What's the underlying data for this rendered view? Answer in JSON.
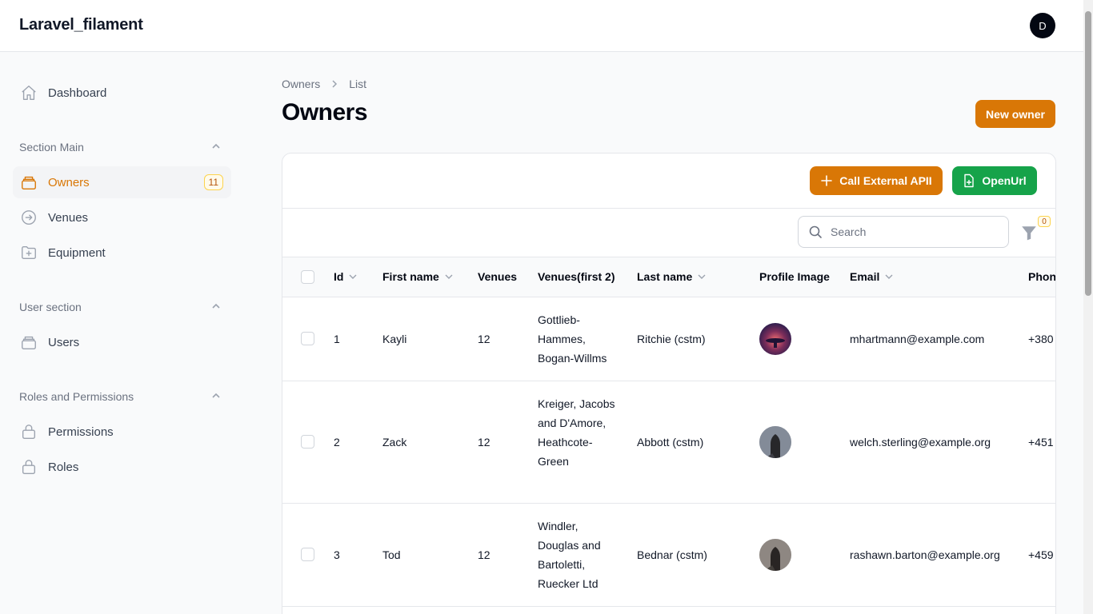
{
  "app": {
    "title": "Laravel_filament",
    "user_initial": "D"
  },
  "sidebar": {
    "dashboard": "Dashboard",
    "groups": [
      {
        "label": "Section Main",
        "items": [
          {
            "label": "Owners",
            "badge": "11",
            "icon": "rectangle-stack-icon",
            "active": true
          },
          {
            "label": "Venues",
            "icon": "arrow-circle-right-icon"
          },
          {
            "label": "Equipment",
            "icon": "folder-plus-icon"
          }
        ]
      },
      {
        "label": "User section",
        "items": [
          {
            "label": "Users",
            "icon": "rectangle-stack-icon"
          }
        ]
      },
      {
        "label": "Roles and Permissions",
        "items": [
          {
            "label": "Permissions",
            "icon": "lock-icon"
          },
          {
            "label": "Roles",
            "icon": "lock-icon"
          }
        ]
      }
    ]
  },
  "breadcrumb": {
    "parent": "Owners",
    "current": "List"
  },
  "page": {
    "title": "Owners",
    "new_button": "New owner"
  },
  "actions": {
    "call_api": "Call External APII",
    "open_url": "OpenUrl"
  },
  "toolbar": {
    "search_placeholder": "Search",
    "filter_count": "0"
  },
  "table": {
    "columns": [
      "Id",
      "First name",
      "Venues",
      "Venues(first 2)",
      "Last name",
      "Profile Image",
      "Email",
      "Phon"
    ],
    "rows": [
      {
        "id": "1",
        "first_name": "Kayli",
        "venues": "12",
        "venues_first2": "Gottlieb-Hammes, Bogan-Willms",
        "last_name": "Ritchie (cstm)",
        "email": "mhartmann@example.com",
        "phone": "+380"
      },
      {
        "id": "2",
        "first_name": "Zack",
        "venues": "12",
        "venues_first2": "Kreiger, Jacobs and D'Amore, Heathcote-Green",
        "last_name": "Abbott (cstm)",
        "email": "welch.sterling@example.org",
        "phone": "+451"
      },
      {
        "id": "3",
        "first_name": "Tod",
        "venues": "12",
        "venues_first2": "Windler, Douglas and Bartoletti, Ruecker Ltd",
        "last_name": "Bednar (cstm)",
        "email": "rashawn.barton@example.org",
        "phone": "+459"
      }
    ]
  },
  "colors": {
    "primary": "#d97706",
    "success": "#16a34a",
    "text": "#111827",
    "muted": "#6b7280"
  }
}
